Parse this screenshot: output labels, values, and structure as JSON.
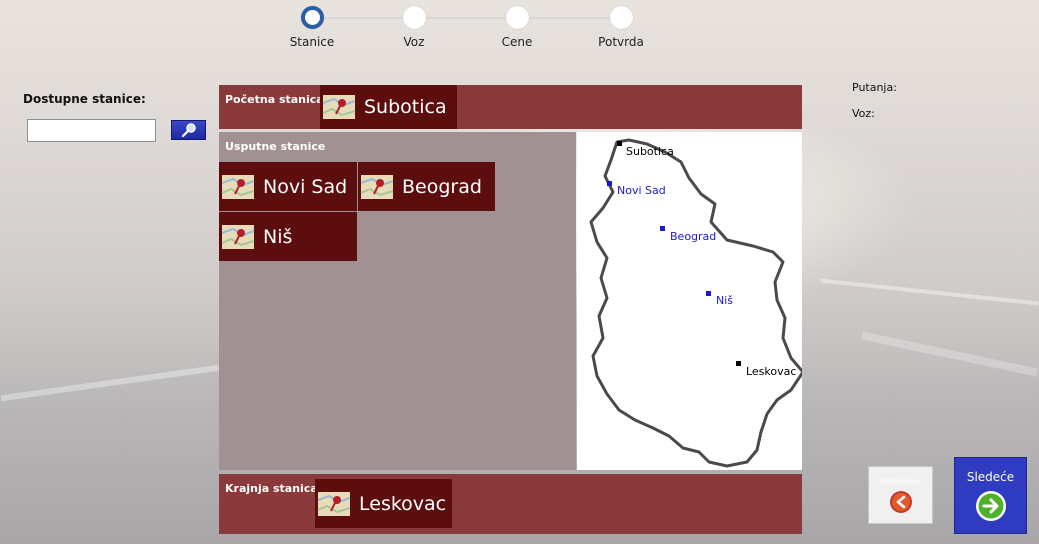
{
  "stepper": {
    "steps": [
      {
        "label": "Stanice",
        "active": true
      },
      {
        "label": "Voz",
        "active": false
      },
      {
        "label": "Cene",
        "active": false
      },
      {
        "label": "Potvrda",
        "active": false
      }
    ]
  },
  "left": {
    "title": "Dostupne stanice:",
    "search_value": "",
    "search_icon": "magnifier-icon"
  },
  "start": {
    "label": "Početna stanica:",
    "station": "Subotica"
  },
  "via": {
    "label": "Usputne stanice",
    "stations": [
      "Novi Sad",
      "Beograd",
      "Niš"
    ]
  },
  "map": {
    "points": [
      {
        "name": "Subotica",
        "color": "#000000"
      },
      {
        "name": "Novi Sad",
        "color": "#1a1ad0"
      },
      {
        "name": "Beograd",
        "color": "#1a1ad0"
      },
      {
        "name": "Niš",
        "color": "#1a1ad0"
      },
      {
        "name": "Leskovac",
        "color": "#000000"
      }
    ]
  },
  "end": {
    "label": "Krajnja stanica:",
    "station": "Leskovac"
  },
  "info": {
    "putanja_label": "Putanja:",
    "voz_label": "Voz:"
  },
  "nav": {
    "prev_label": "Prethodno",
    "next_label": "Sledeće"
  },
  "colors": {
    "panel": "#8b3a3b",
    "tile": "#5c0d0d",
    "via_bg": "#a29192",
    "next_btn": "#2f3bc1",
    "active_step": "#2a5ea6"
  }
}
